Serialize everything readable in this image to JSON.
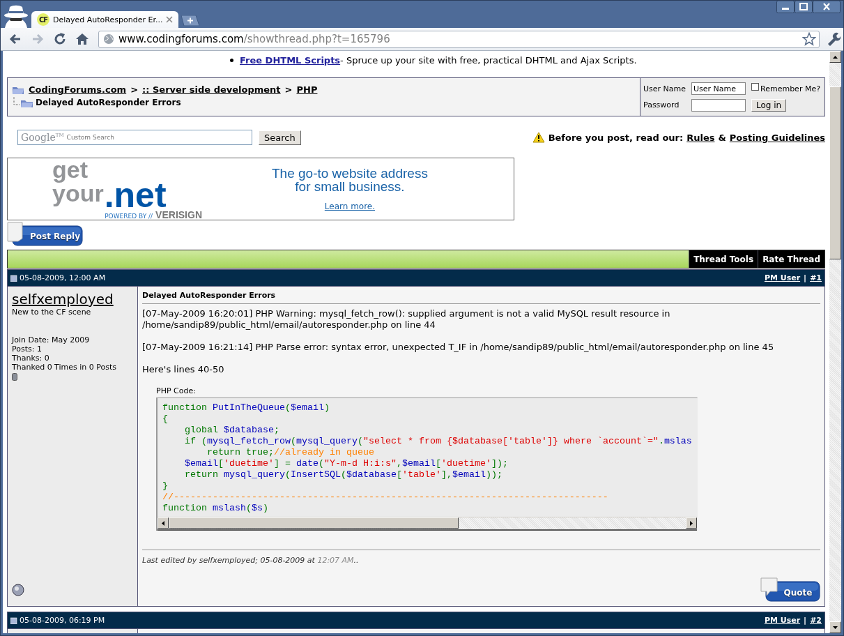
{
  "browser": {
    "tab": {
      "favicon_text": "CF",
      "title": "Delayed AutoResponder Er...",
      "selected": true
    },
    "address": {
      "host": "www.codingforums.com",
      "path": "/showthread.php?t=165796"
    }
  },
  "promo": {
    "link": "Free DHTML Scripts",
    "text": "- Spruce up your site with free, practical DHTML and Ajax Scripts."
  },
  "breadcrumb": {
    "crumbs": [
      {
        "label": "CodingForums.com",
        "separator": ">"
      },
      {
        "label": ":: Server side development",
        "separator": ">"
      },
      {
        "label": "PHP"
      }
    ],
    "current": "Delayed AutoResponder Errors"
  },
  "login": {
    "username_label": "User Name",
    "username_value": "User Name",
    "remember_label": "Remember Me?",
    "remember_checked": false,
    "password_label": "Password",
    "button": "Log in"
  },
  "search": {
    "brand": "Google$^{TM}$",
    "placeholder": "Custom Search",
    "button": "Search"
  },
  "notice": {
    "text": "Before you post, read our:",
    "rules": "Rules",
    "joiner": "&",
    "guidelines": "Posting Guidelines"
  },
  "ad": {
    "logo_top": "get",
    "logo_mid": "your",
    "logo_tld": ".net",
    "powered": "POWERED BY //",
    "brand": "VERISIGN",
    "headline": "The go-to website address",
    "headline2": "for small business.",
    "link": "Learn more."
  },
  "post_reply": "Post Reply",
  "thread_menus": [
    "Thread Tools",
    "Rate Thread"
  ],
  "posts": [
    {
      "date": "05-08-2009, 12:00 AM",
      "pm": "PM User",
      "separator": "|",
      "number": "#1",
      "username": "selfxemployed",
      "user_title": "New to the CF scene",
      "stats": [
        "Join Date: May 2009",
        "Posts: 1",
        "Thanks: 0",
        "Thanked 0 Times in 0 Posts"
      ],
      "online": false,
      "title": "Delayed AutoResponder Errors",
      "paragraphs": [
        "[07-May-2009 16:20:01] PHP Warning: mysql_fetch_row(): supplied argument is not a valid MySQL result resource in /home/sandip89/public_html/email/autoresponder.php on line 44",
        "[07-May-2009 16:21:14] PHP Parse error: syntax error, unexpected T_IF in /home/sandip89/public_html/email/autoresponder.php on line 45",
        "Here's lines 40-50"
      ],
      "code": {
        "label": "PHP Code:",
        "lines": [
          [
            {
              "kind": "keyword",
              "text": "function "
            },
            {
              "kind": "default",
              "text": "PutInTheQueue"
            },
            {
              "kind": "keyword",
              "text": "("
            },
            {
              "kind": "default",
              "text": "$email"
            },
            {
              "kind": "keyword",
              "text": ")"
            }
          ],
          [
            {
              "kind": "keyword",
              "text": "{"
            }
          ],
          [
            {
              "kind": "keyword",
              "text": "    global "
            },
            {
              "kind": "default",
              "text": "$database"
            },
            {
              "kind": "keyword",
              "text": ";"
            }
          ],
          [
            {
              "kind": "keyword",
              "text": "    if ("
            },
            {
              "kind": "default",
              "text": "mysql_fetch_row"
            },
            {
              "kind": "keyword",
              "text": "("
            },
            {
              "kind": "default",
              "text": "mysql_query"
            },
            {
              "kind": "keyword",
              "text": "("
            },
            {
              "kind": "string",
              "text": "\"select * from {$database['table']} where `account`=\""
            },
            {
              "kind": "keyword",
              "text": "."
            },
            {
              "kind": "default",
              "text": "mslas"
            }
          ],
          [
            {
              "kind": "keyword",
              "text": "        return true;"
            },
            {
              "kind": "comment",
              "text": "//already in queue"
            }
          ],
          [
            {
              "kind": "default",
              "text": "    $email"
            },
            {
              "kind": "keyword",
              "text": "["
            },
            {
              "kind": "string",
              "text": "'duetime'"
            },
            {
              "kind": "keyword",
              "text": "] = "
            },
            {
              "kind": "default",
              "text": "date"
            },
            {
              "kind": "keyword",
              "text": "("
            },
            {
              "kind": "string",
              "text": "\"Y-m-d H:i:s\""
            },
            {
              "kind": "keyword",
              "text": ","
            },
            {
              "kind": "default",
              "text": "$email"
            },
            {
              "kind": "keyword",
              "text": "["
            },
            {
              "kind": "string",
              "text": "'duetime'"
            },
            {
              "kind": "keyword",
              "text": "]);"
            }
          ],
          [
            {
              "kind": "keyword",
              "text": "    return "
            },
            {
              "kind": "default",
              "text": "mysql_query"
            },
            {
              "kind": "keyword",
              "text": "("
            },
            {
              "kind": "default",
              "text": "InsertSQL"
            },
            {
              "kind": "keyword",
              "text": "("
            },
            {
              "kind": "default",
              "text": "$database"
            },
            {
              "kind": "keyword",
              "text": "["
            },
            {
              "kind": "string",
              "text": "'table'"
            },
            {
              "kind": "keyword",
              "text": "],"
            },
            {
              "kind": "default",
              "text": "$email"
            },
            {
              "kind": "keyword",
              "text": "));"
            }
          ],
          [
            {
              "kind": "keyword",
              "text": "}"
            }
          ],
          [
            {
              "kind": "comment",
              "text": "//------------------------------------------------------------------------------"
            }
          ],
          [
            {
              "kind": "keyword",
              "text": "function "
            },
            {
              "kind": "default",
              "text": "mslash"
            },
            {
              "kind": "keyword",
              "text": "("
            },
            {
              "kind": "default",
              "text": "$s"
            },
            {
              "kind": "keyword",
              "text": ")"
            }
          ]
        ]
      },
      "edited": {
        "text": "Last edited by selfxemployed; 05-08-2009 at",
        "time": "12:07 AM",
        "suffix": ".."
      },
      "quote": "Quote"
    },
    {
      "date": "05-08-2009, 06:19 PM",
      "pm": "PM User",
      "separator": "|",
      "number": "#2"
    }
  ]
}
